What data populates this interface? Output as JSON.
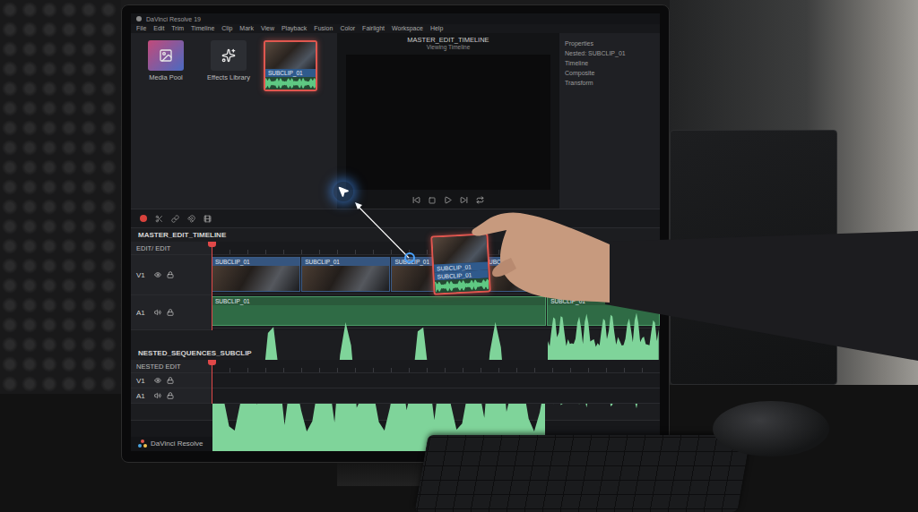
{
  "window": {
    "title": "DaVinci Resolve 19"
  },
  "menu": [
    "File",
    "Edit",
    "Trim",
    "Timeline",
    "Clip",
    "Mark",
    "View",
    "Playback",
    "Fusion",
    "Color",
    "Fairlight",
    "Workspace",
    "Help"
  ],
  "media_pool": {
    "items": [
      {
        "label": "Media Pool",
        "kind": "icon",
        "selected": false
      },
      {
        "label": "Effects Library",
        "kind": "icon",
        "selected": false
      },
      {
        "label": "SUBCLIP_01",
        "kind": "clip",
        "selected": true
      }
    ]
  },
  "viewer": {
    "title": "MASTER_EDIT_TIMELINE",
    "subtitle": "Viewing Timeline"
  },
  "inspector": {
    "lines": [
      "Properties",
      "Nested: SUBCLIP_01",
      "Timeline",
      "Composite",
      "Transform"
    ]
  },
  "master_timeline": {
    "name": "MASTER_EDIT_TIMELINE",
    "mode": "EDIT/ EDIT",
    "tracks": [
      {
        "name": "V1",
        "kind": "video"
      },
      {
        "name": "A1",
        "kind": "audio"
      }
    ],
    "video_clips": [
      "SUBCLIP_01",
      "SUBCLIP_01",
      "SUBCLIP_01",
      "SUBCLIP_01",
      "SUBCLIP_01"
    ],
    "audio_clips": [
      "SUBCLIP_01",
      "SUBCLIP_01"
    ]
  },
  "dragged_clip": {
    "label": "SUBCLIP_01",
    "sublabel": "SUBCLIP_01"
  },
  "nested_timeline": {
    "name": "NESTED_SEQUENCES_SUBCLIP",
    "mode": "NESTED EDIT",
    "tracks": [
      {
        "name": "V1",
        "kind": "video"
      },
      {
        "name": "A1",
        "kind": "audio"
      }
    ]
  },
  "page_tabs": [
    {
      "selected": false
    },
    {
      "selected": false
    },
    {
      "selected": false
    },
    {
      "selected": true
    },
    {
      "selected": false
    }
  ],
  "brand": "DaVinci Resolve"
}
